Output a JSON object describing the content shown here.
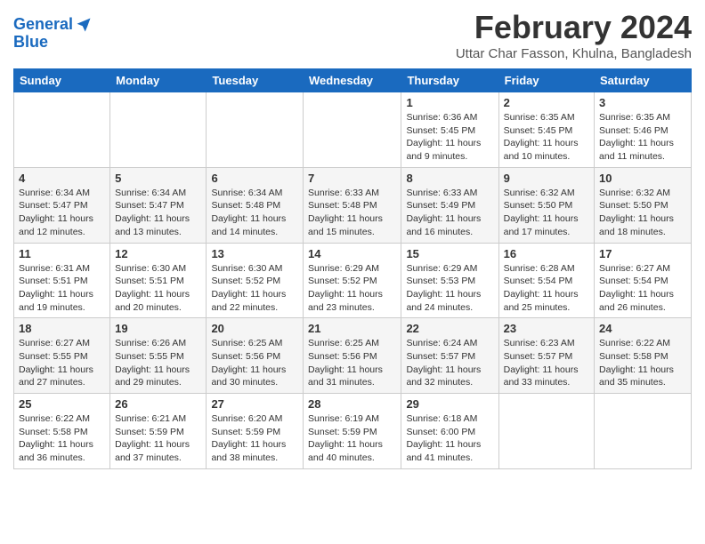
{
  "logo": {
    "line1": "General",
    "line2": "Blue"
  },
  "title": {
    "month_year": "February 2024",
    "location": "Uttar Char Fasson, Khulna, Bangladesh"
  },
  "headers": [
    "Sunday",
    "Monday",
    "Tuesday",
    "Wednesday",
    "Thursday",
    "Friday",
    "Saturday"
  ],
  "weeks": [
    [
      {
        "num": "",
        "info": ""
      },
      {
        "num": "",
        "info": ""
      },
      {
        "num": "",
        "info": ""
      },
      {
        "num": "",
        "info": ""
      },
      {
        "num": "1",
        "info": "Sunrise: 6:36 AM\nSunset: 5:45 PM\nDaylight: 11 hours\nand 9 minutes."
      },
      {
        "num": "2",
        "info": "Sunrise: 6:35 AM\nSunset: 5:45 PM\nDaylight: 11 hours\nand 10 minutes."
      },
      {
        "num": "3",
        "info": "Sunrise: 6:35 AM\nSunset: 5:46 PM\nDaylight: 11 hours\nand 11 minutes."
      }
    ],
    [
      {
        "num": "4",
        "info": "Sunrise: 6:34 AM\nSunset: 5:47 PM\nDaylight: 11 hours\nand 12 minutes."
      },
      {
        "num": "5",
        "info": "Sunrise: 6:34 AM\nSunset: 5:47 PM\nDaylight: 11 hours\nand 13 minutes."
      },
      {
        "num": "6",
        "info": "Sunrise: 6:34 AM\nSunset: 5:48 PM\nDaylight: 11 hours\nand 14 minutes."
      },
      {
        "num": "7",
        "info": "Sunrise: 6:33 AM\nSunset: 5:48 PM\nDaylight: 11 hours\nand 15 minutes."
      },
      {
        "num": "8",
        "info": "Sunrise: 6:33 AM\nSunset: 5:49 PM\nDaylight: 11 hours\nand 16 minutes."
      },
      {
        "num": "9",
        "info": "Sunrise: 6:32 AM\nSunset: 5:50 PM\nDaylight: 11 hours\nand 17 minutes."
      },
      {
        "num": "10",
        "info": "Sunrise: 6:32 AM\nSunset: 5:50 PM\nDaylight: 11 hours\nand 18 minutes."
      }
    ],
    [
      {
        "num": "11",
        "info": "Sunrise: 6:31 AM\nSunset: 5:51 PM\nDaylight: 11 hours\nand 19 minutes."
      },
      {
        "num": "12",
        "info": "Sunrise: 6:30 AM\nSunset: 5:51 PM\nDaylight: 11 hours\nand 20 minutes."
      },
      {
        "num": "13",
        "info": "Sunrise: 6:30 AM\nSunset: 5:52 PM\nDaylight: 11 hours\nand 22 minutes."
      },
      {
        "num": "14",
        "info": "Sunrise: 6:29 AM\nSunset: 5:52 PM\nDaylight: 11 hours\nand 23 minutes."
      },
      {
        "num": "15",
        "info": "Sunrise: 6:29 AM\nSunset: 5:53 PM\nDaylight: 11 hours\nand 24 minutes."
      },
      {
        "num": "16",
        "info": "Sunrise: 6:28 AM\nSunset: 5:54 PM\nDaylight: 11 hours\nand 25 minutes."
      },
      {
        "num": "17",
        "info": "Sunrise: 6:27 AM\nSunset: 5:54 PM\nDaylight: 11 hours\nand 26 minutes."
      }
    ],
    [
      {
        "num": "18",
        "info": "Sunrise: 6:27 AM\nSunset: 5:55 PM\nDaylight: 11 hours\nand 27 minutes."
      },
      {
        "num": "19",
        "info": "Sunrise: 6:26 AM\nSunset: 5:55 PM\nDaylight: 11 hours\nand 29 minutes."
      },
      {
        "num": "20",
        "info": "Sunrise: 6:25 AM\nSunset: 5:56 PM\nDaylight: 11 hours\nand 30 minutes."
      },
      {
        "num": "21",
        "info": "Sunrise: 6:25 AM\nSunset: 5:56 PM\nDaylight: 11 hours\nand 31 minutes."
      },
      {
        "num": "22",
        "info": "Sunrise: 6:24 AM\nSunset: 5:57 PM\nDaylight: 11 hours\nand 32 minutes."
      },
      {
        "num": "23",
        "info": "Sunrise: 6:23 AM\nSunset: 5:57 PM\nDaylight: 11 hours\nand 33 minutes."
      },
      {
        "num": "24",
        "info": "Sunrise: 6:22 AM\nSunset: 5:58 PM\nDaylight: 11 hours\nand 35 minutes."
      }
    ],
    [
      {
        "num": "25",
        "info": "Sunrise: 6:22 AM\nSunset: 5:58 PM\nDaylight: 11 hours\nand 36 minutes."
      },
      {
        "num": "26",
        "info": "Sunrise: 6:21 AM\nSunset: 5:59 PM\nDaylight: 11 hours\nand 37 minutes."
      },
      {
        "num": "27",
        "info": "Sunrise: 6:20 AM\nSunset: 5:59 PM\nDaylight: 11 hours\nand 38 minutes."
      },
      {
        "num": "28",
        "info": "Sunrise: 6:19 AM\nSunset: 5:59 PM\nDaylight: 11 hours\nand 40 minutes."
      },
      {
        "num": "29",
        "info": "Sunrise: 6:18 AM\nSunset: 6:00 PM\nDaylight: 11 hours\nand 41 minutes."
      },
      {
        "num": "",
        "info": ""
      },
      {
        "num": "",
        "info": ""
      }
    ]
  ]
}
